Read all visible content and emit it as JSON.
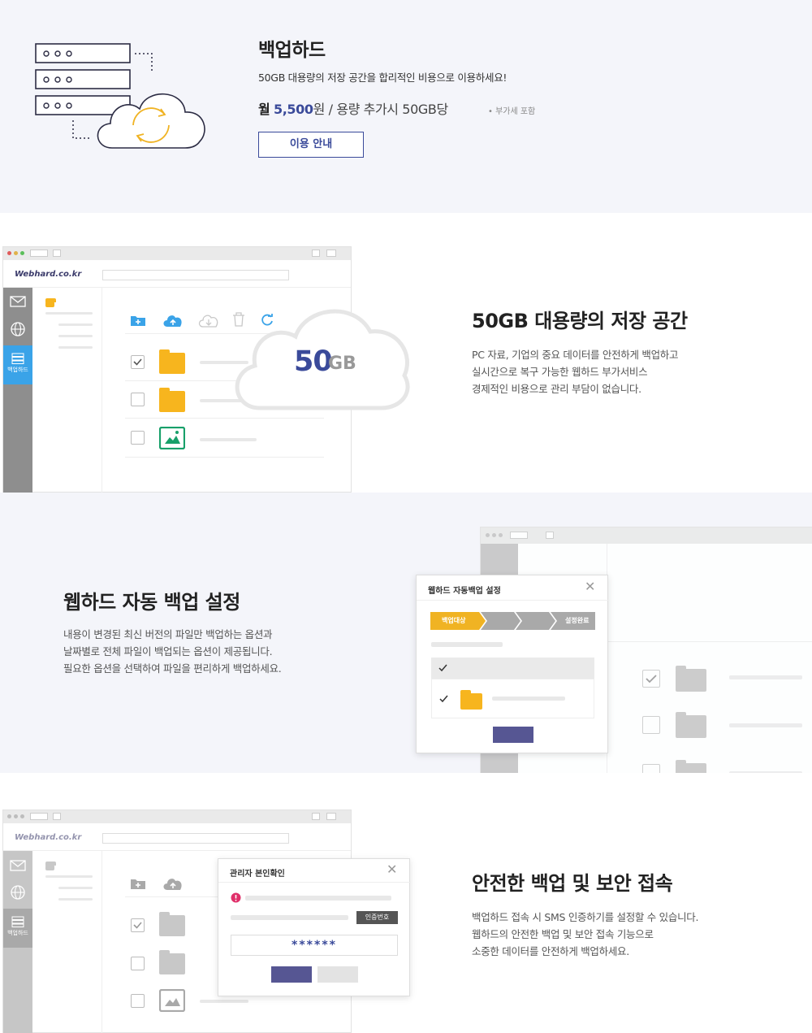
{
  "hero": {
    "title": "백업하드",
    "description": "50GB 대용량의 저장 공간을 합리적인 비용으로 이용하세요!",
    "price_prefix": "월",
    "price_amount": "5,500",
    "price_unit": "원",
    "price_suffix": " / 용량 추가시 50GB당",
    "vat_note": "• 부가세 포함",
    "guide_button": "이용 안내"
  },
  "feature1": {
    "title": "50GB 대용량의 저장 공간",
    "lines": [
      "PC 자료, 기업의 중요 데이터를 안전하게 백업하고",
      "실시간으로 복구 가능한 웹하드 부가서비스",
      "경제적인 비용으로 관리 부담이 없습니다."
    ],
    "cloud_number": "50",
    "cloud_unit": "GB",
    "logo": "Webhard.co.kr",
    "side_active_label": "백업하드"
  },
  "feature2": {
    "title": "웹하드 자동 백업 설정",
    "lines": [
      "내용이 변경된 최신 버전의 파일만 백업하는 옵션과",
      "날짜별로 전체 파일이 백업되는 옵션이 제공됩니다.",
      "필요한 옵션을 선택하여 파일을 편리하게 백업하세요."
    ],
    "dialog_title": "웹하드 자동백업 설정",
    "step_first": "백업대상",
    "step_last": "설정완료"
  },
  "feature3": {
    "title": "안전한 백업 및 보안 접속",
    "lines": [
      "백업하드 접속 시 SMS 인증하기를 설정할 수 있습니다.",
      "웹하드의 안전한 백업 및 보안 접속 기능으로",
      "소중한 데이터를 안전하게 백업하세요."
    ],
    "dialog_title": "관리자 본인확인",
    "verify_button": "인증번호",
    "password_mask": "******",
    "logo": "Webhard.co.kr",
    "side_active_label": "백업하드"
  },
  "colors": {
    "accent": "#3a4a9a",
    "folder": "#f7b51e",
    "side_active": "#3aa3e8",
    "step": "#f0b323"
  }
}
